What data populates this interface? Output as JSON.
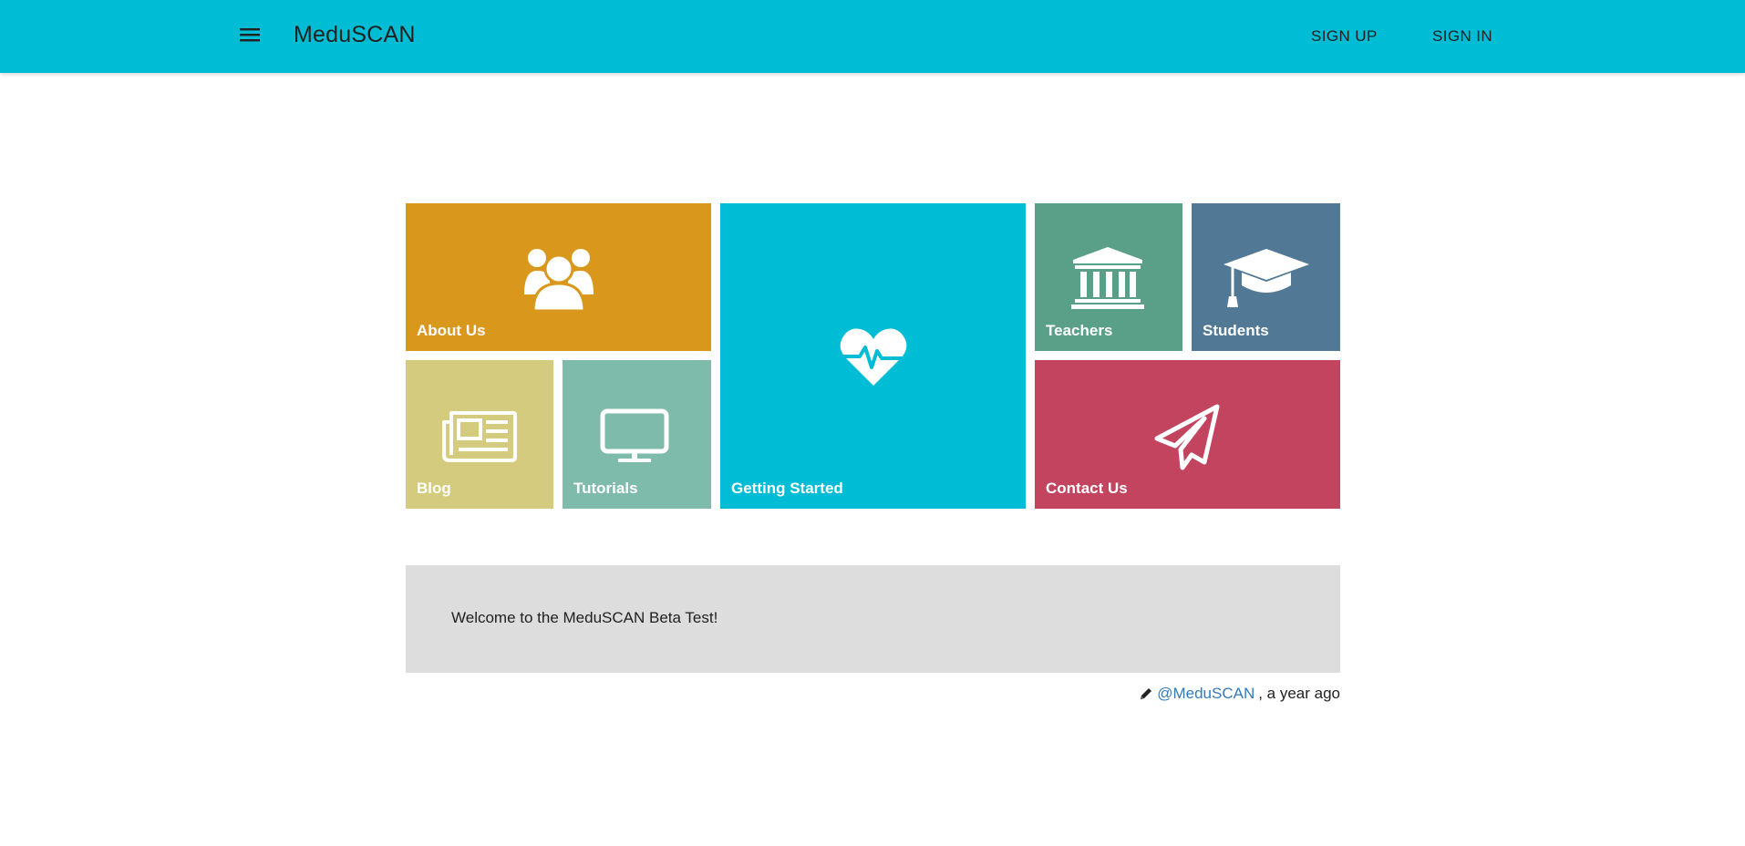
{
  "header": {
    "menu_icon": "hamburger-menu-icon",
    "title": "MeduSCAN",
    "nav": {
      "sign_up": "SIGN UP",
      "sign_in": "SIGN IN"
    },
    "background_color": "#00bcd4"
  },
  "tiles": {
    "about": {
      "label": "About Us",
      "icon": "users-icon",
      "color": "#d9981c"
    },
    "getting": {
      "label": "Getting Started",
      "icon": "heartbeat-icon",
      "color": "#00bcd4"
    },
    "teachers": {
      "label": "Teachers",
      "icon": "institution-icon",
      "color": "#5aa088"
    },
    "students": {
      "label": "Students",
      "icon": "graduation-cap-icon",
      "color": "#517895"
    },
    "blog": {
      "label": "Blog",
      "icon": "newspaper-icon",
      "color": "#d4cb7f"
    },
    "tutorials": {
      "label": "Tutorials",
      "icon": "monitor-icon",
      "color": "#7fbbab"
    },
    "contact": {
      "label": "Contact Us",
      "icon": "paper-plane-icon",
      "color": "#c2445e"
    }
  },
  "announcement": {
    "text": "Welcome to the MeduSCAN Beta Test!",
    "author": "@MeduSCAN",
    "time": ", a year ago",
    "edit_icon": "pencil-icon",
    "background_color": "#dddddd"
  }
}
